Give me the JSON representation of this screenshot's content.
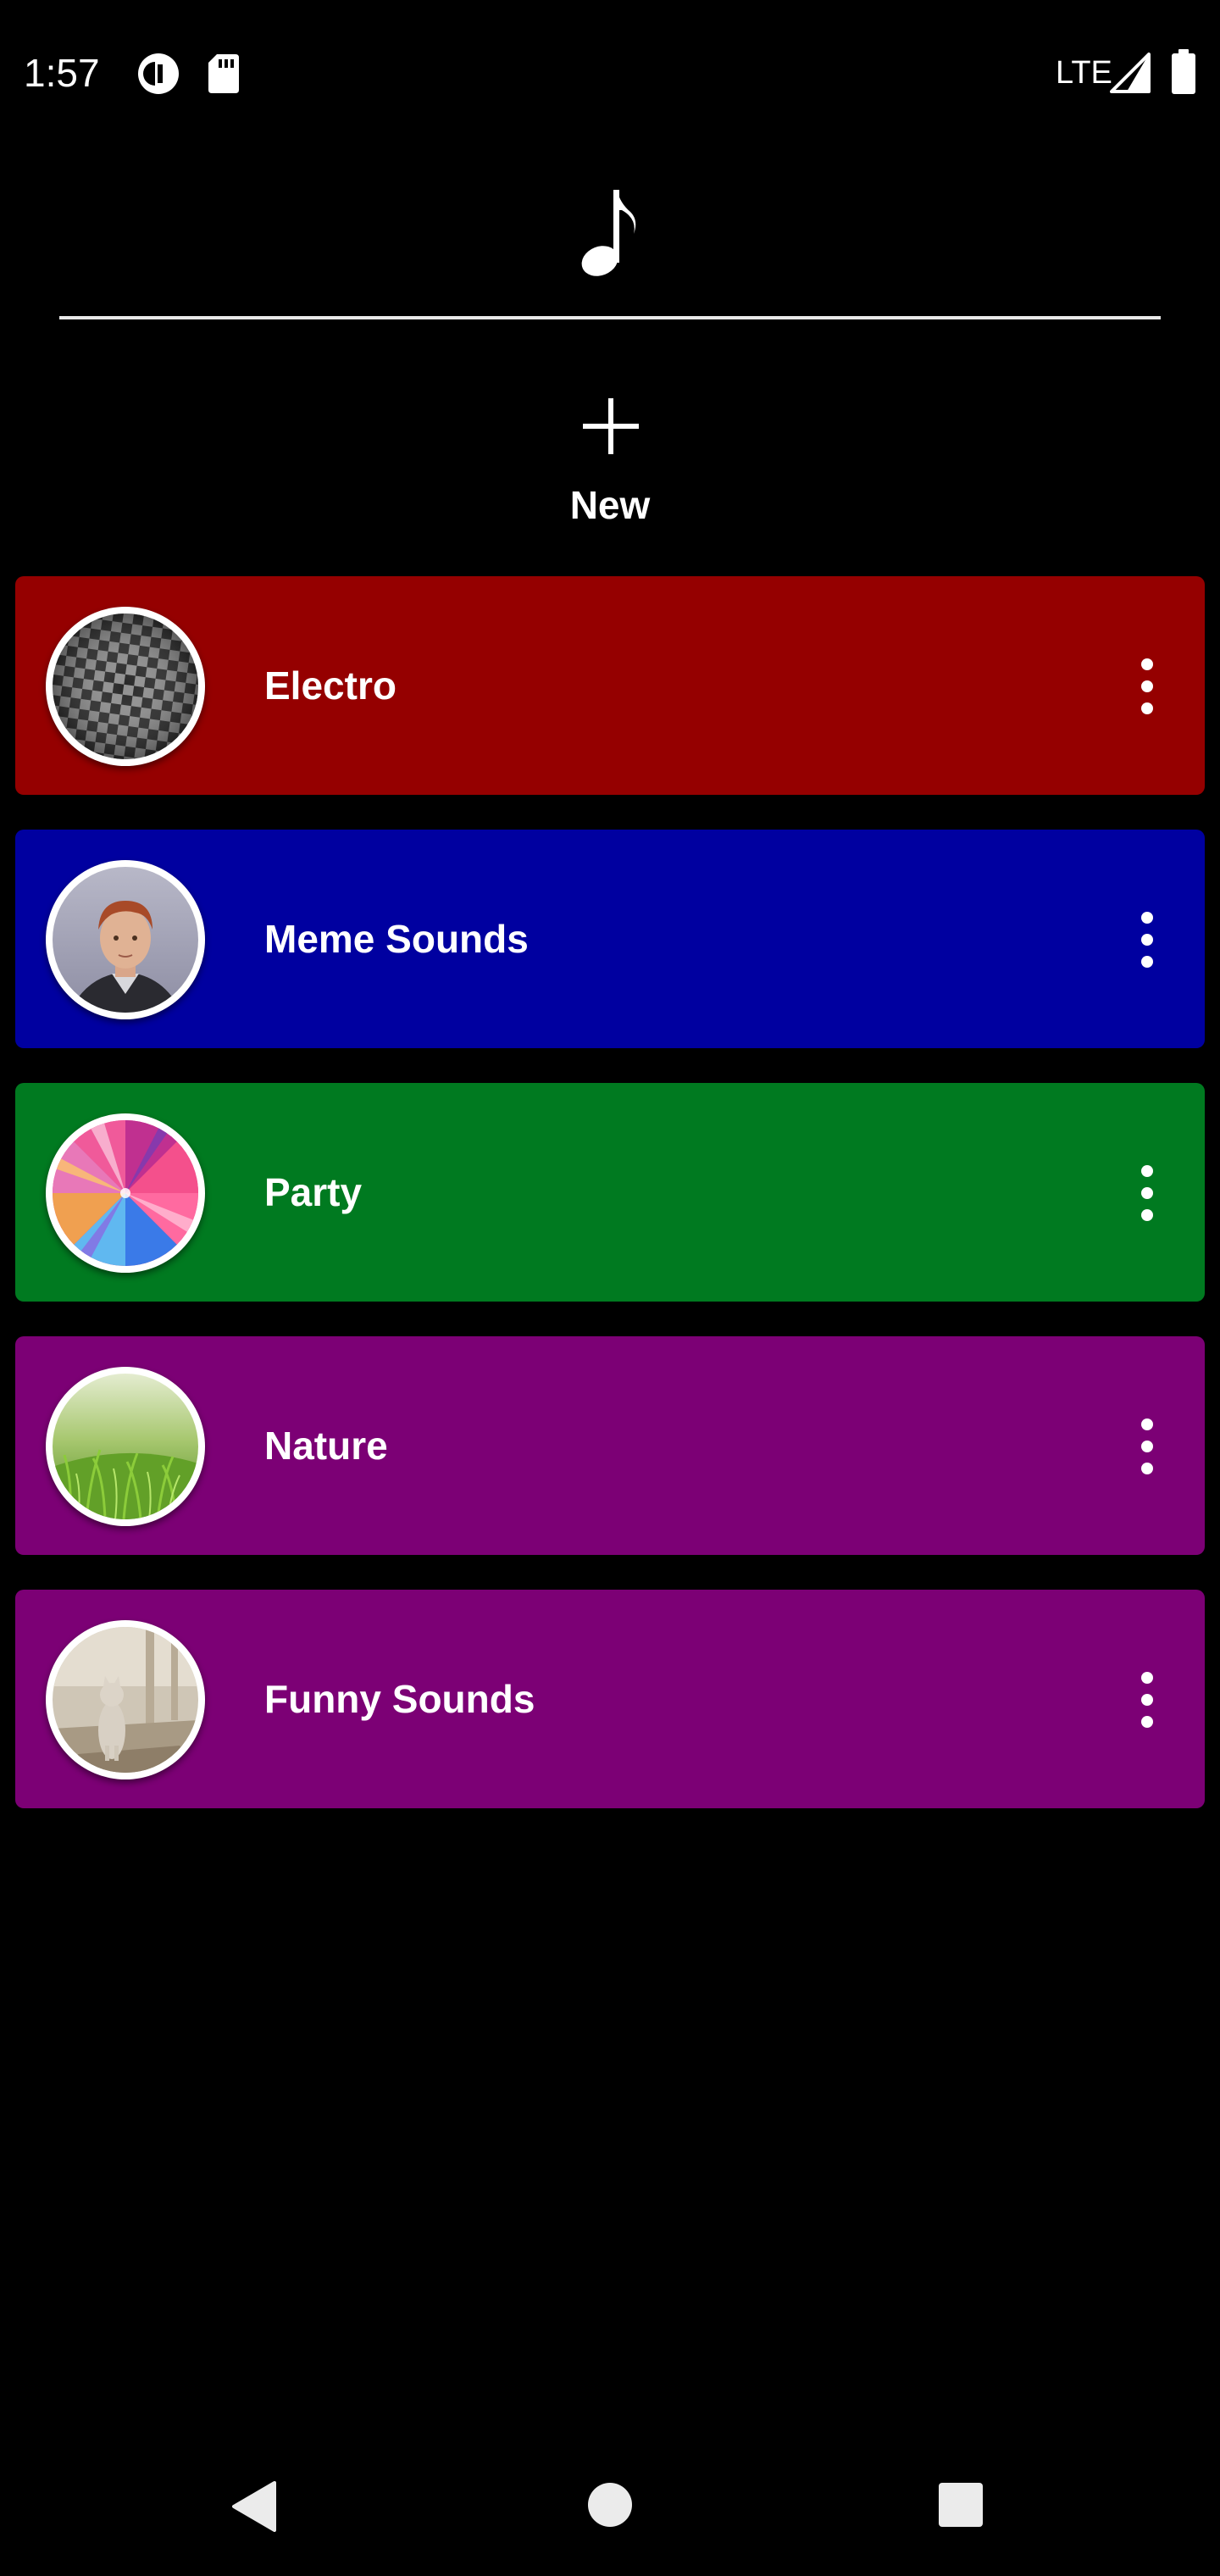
{
  "status_bar": {
    "time": "1:57",
    "network": "LTE",
    "icons": [
      "status-app-icon",
      "sd-card-icon",
      "signal-icon",
      "battery-icon"
    ]
  },
  "header": {
    "icon": "music-note-icon"
  },
  "new_button": {
    "label": "New",
    "icon": "plus-icon"
  },
  "categories": [
    {
      "name": "Electro",
      "color": "#950000",
      "image": "checkerboard-image"
    },
    {
      "name": "Meme Sounds",
      "color": "#0000A0",
      "image": "person-photo"
    },
    {
      "name": "Party",
      "color": "#007A20",
      "image": "colorful-swirl-image"
    },
    {
      "name": "Nature",
      "color": "#7C0075",
      "image": "grass-photo"
    },
    {
      "name": "Funny Sounds",
      "color": "#7C0075",
      "image": "cat-photo"
    }
  ],
  "nav_bar": {
    "icons": [
      "back-icon",
      "home-icon",
      "recents-icon"
    ]
  }
}
